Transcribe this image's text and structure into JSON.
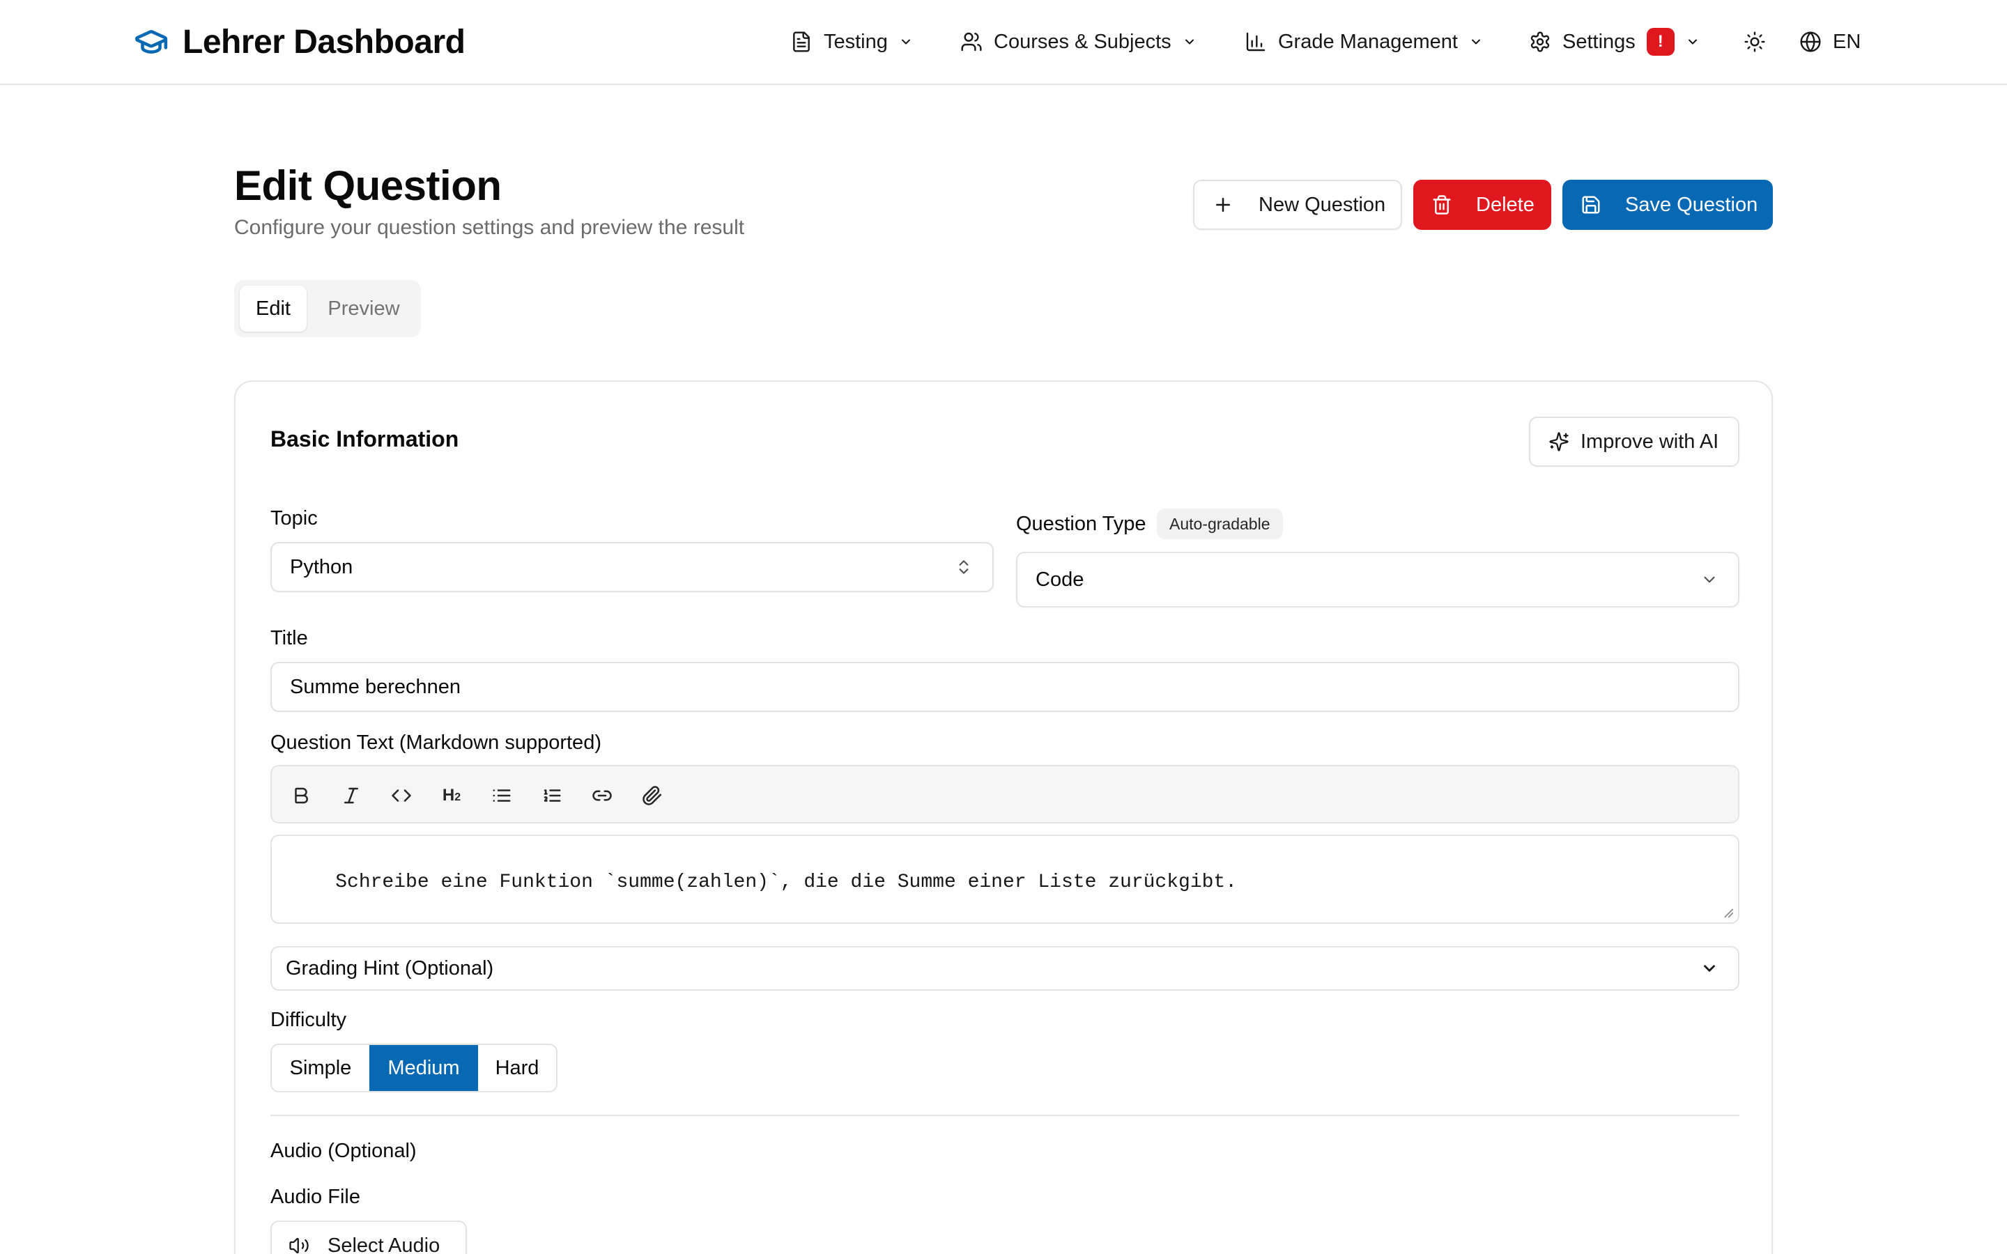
{
  "app": {
    "title": "Lehrer Dashboard"
  },
  "nav": {
    "items": [
      {
        "label": "Testing",
        "icon": "file-text-icon"
      },
      {
        "label": "Courses & Subjects",
        "icon": "users-icon"
      },
      {
        "label": "Grade Management",
        "icon": "bar-chart-icon"
      },
      {
        "label": "Settings",
        "icon": "gear-icon",
        "badge": "!"
      }
    ],
    "theme_icon": "sun-icon",
    "language": "EN"
  },
  "page": {
    "title": "Edit Question",
    "subtitle": "Configure your question settings and preview the result"
  },
  "actions": {
    "new_label": "New Question",
    "delete_label": "Delete",
    "save_label": "Save Question"
  },
  "tabs": [
    {
      "label": "Edit",
      "active": true
    },
    {
      "label": "Preview",
      "active": false
    }
  ],
  "form": {
    "section_title": "Basic Information",
    "improve_label": "Improve with AI",
    "topic": {
      "label": "Topic",
      "value": "Python"
    },
    "question_type": {
      "label": "Question Type",
      "badge": "Auto-gradable",
      "value": "Code"
    },
    "title": {
      "label": "Title",
      "value": "Summe berechnen"
    },
    "question_text": {
      "label": "Question Text (Markdown supported)",
      "value": "Schreibe eine Funktion `summe(zahlen)`, die die Summe einer Liste zurückgibt."
    },
    "toolbar": {
      "tools": [
        "bold",
        "italic",
        "code",
        "heading-2",
        "bullet-list",
        "numbered-list",
        "link",
        "attachment"
      ],
      "heading_label": "H",
      "heading_sub": "2"
    },
    "grading_hint": {
      "label": "Grading Hint (Optional)"
    },
    "difficulty": {
      "label": "Difficulty",
      "options": [
        "Simple",
        "Medium",
        "Hard"
      ],
      "selected": "Medium"
    },
    "audio": {
      "section_label": "Audio (Optional)",
      "file_label": "Audio File",
      "select_label": "Select Audio"
    }
  },
  "colors": {
    "primary": "#0768b4",
    "danger": "#e0171d",
    "muted_text": "#6b6b6b",
    "border": "#e2e2e2"
  }
}
